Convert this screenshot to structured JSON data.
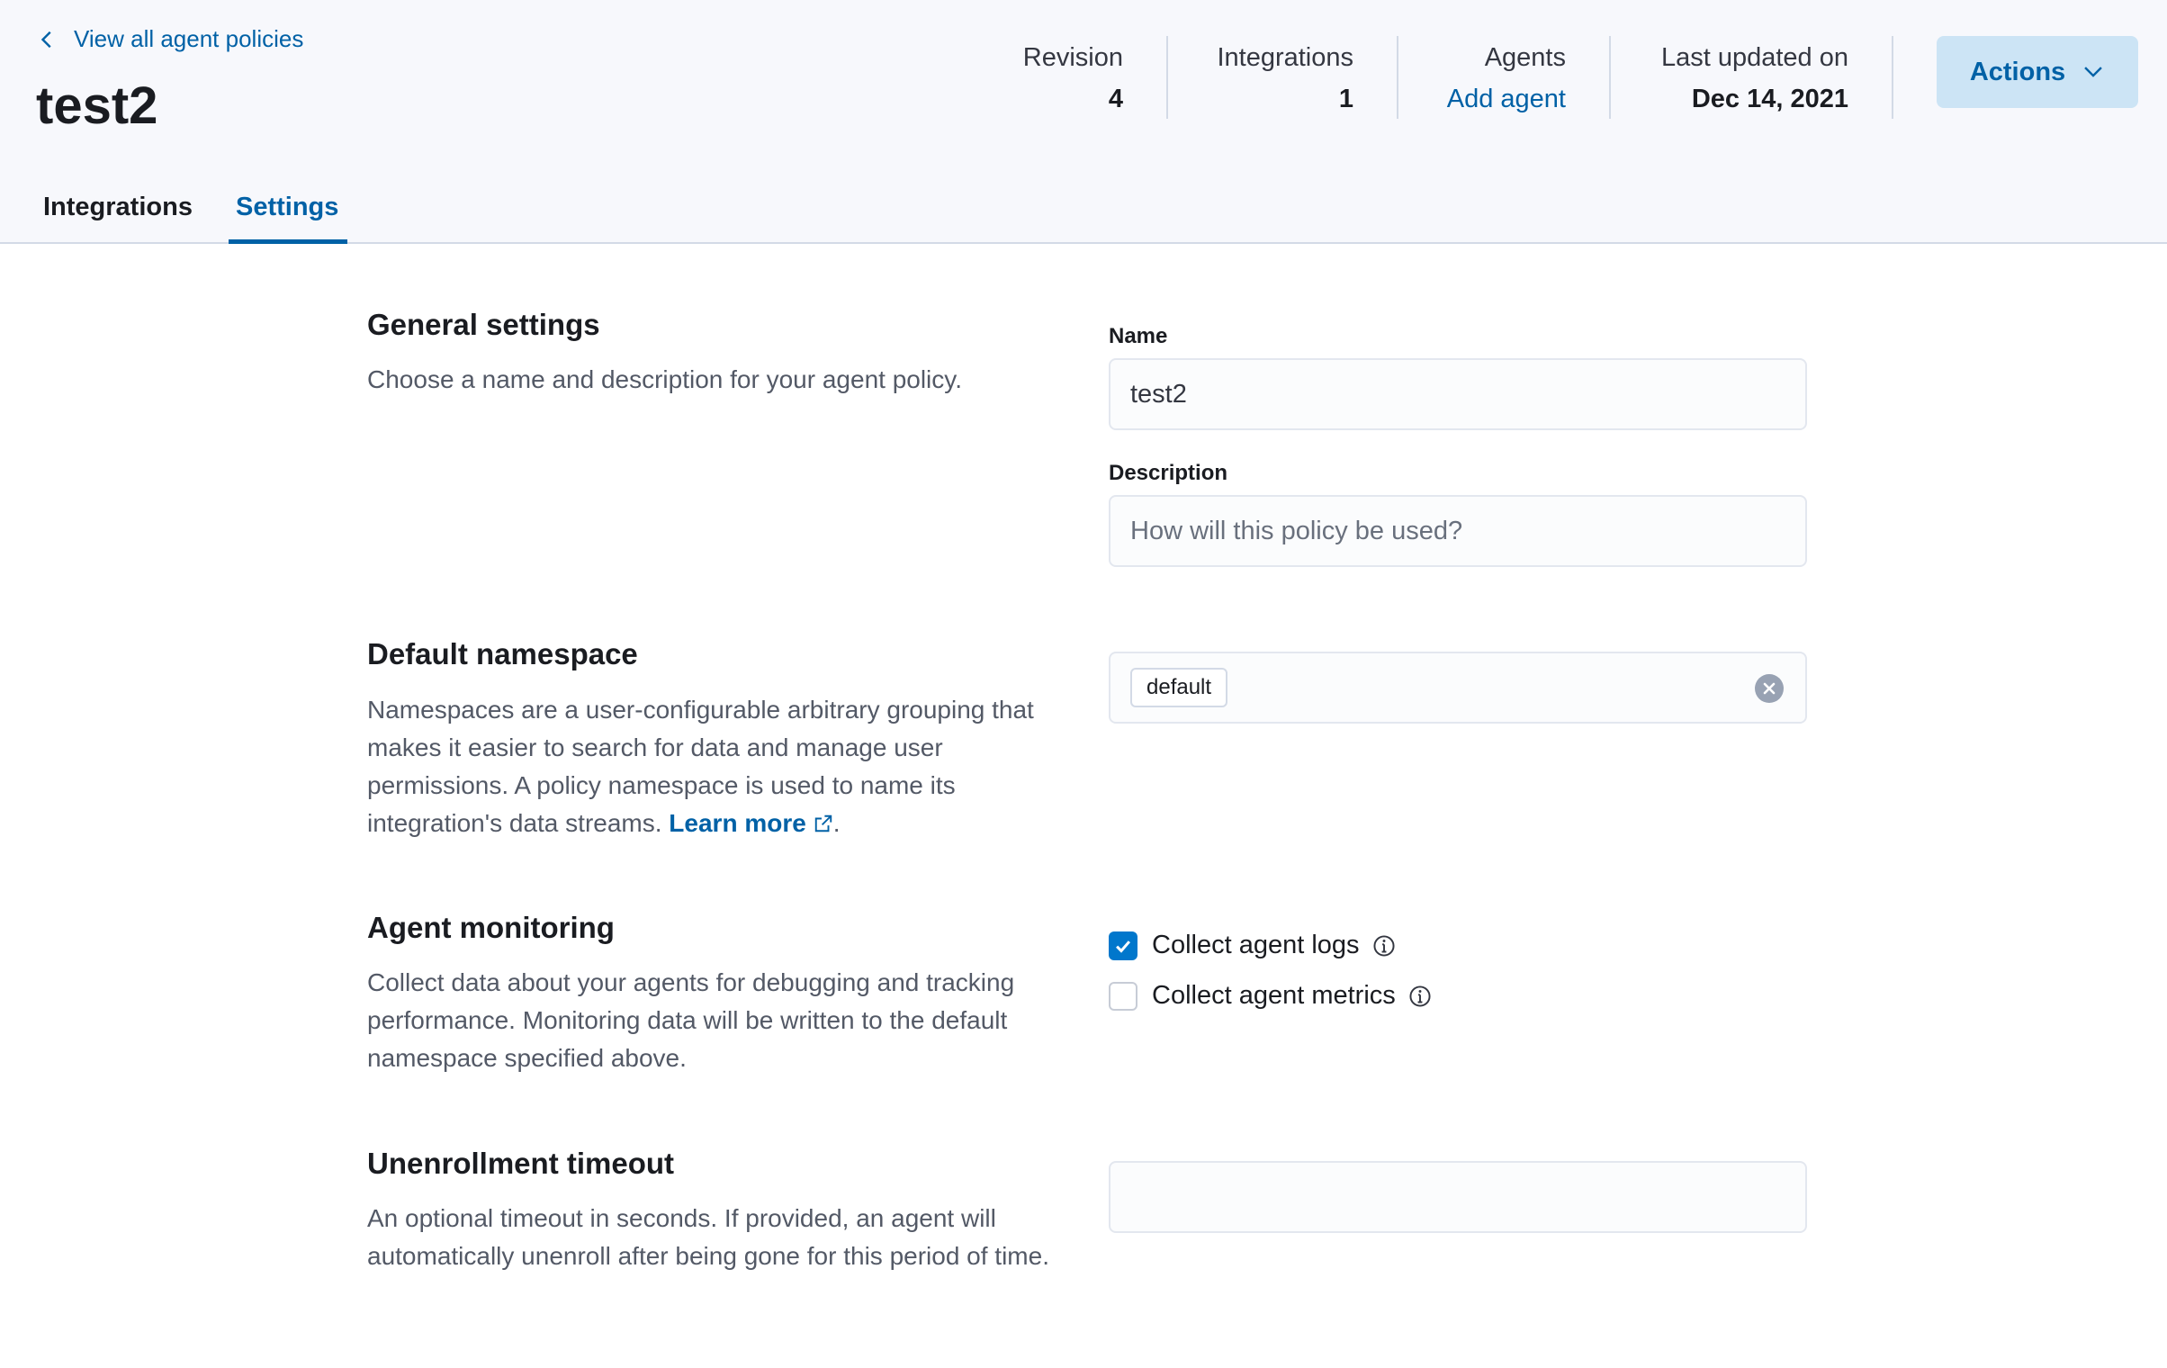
{
  "header": {
    "back_link": "View all agent policies",
    "title": "test2",
    "stats": {
      "revision": {
        "label": "Revision",
        "value": "4"
      },
      "integrations": {
        "label": "Integrations",
        "value": "1"
      },
      "agents": {
        "label": "Agents",
        "value": "Add agent"
      },
      "last_updated": {
        "label": "Last updated on",
        "value": "Dec 14, 2021"
      }
    },
    "actions_label": "Actions"
  },
  "tabs": [
    {
      "label": "Integrations",
      "active": false
    },
    {
      "label": "Settings",
      "active": true
    }
  ],
  "sections": {
    "general": {
      "title": "General settings",
      "description": "Choose a name and description for your agent policy.",
      "name_label": "Name",
      "name_value": "test2",
      "description_label": "Description",
      "description_placeholder": "How will this policy be used?"
    },
    "namespace": {
      "title": "Default namespace",
      "description": "Namespaces are a user-configurable arbitrary grouping that makes it easier to search for data and manage user permissions. A policy namespace is used to name its integration's data streams.",
      "learn_more": "Learn more",
      "period": ".",
      "value": "default"
    },
    "monitoring": {
      "title": "Agent monitoring",
      "description": "Collect data about your agents for debugging and tracking performance. Monitoring data will be written to the default namespace specified above.",
      "collect_logs": {
        "label": "Collect agent logs",
        "checked": true
      },
      "collect_metrics": {
        "label": "Collect agent metrics",
        "checked": false
      }
    },
    "unenrollment": {
      "title": "Unenrollment timeout",
      "description": "An optional timeout in seconds. If provided, an agent will automatically unenroll after being gone for this period of time.",
      "value": ""
    }
  },
  "colors": {
    "accent": "#0061a6",
    "header_bg": "#f7f8fc",
    "actions_bg": "#cce4f5",
    "checkbox_on": "#0077cc"
  }
}
